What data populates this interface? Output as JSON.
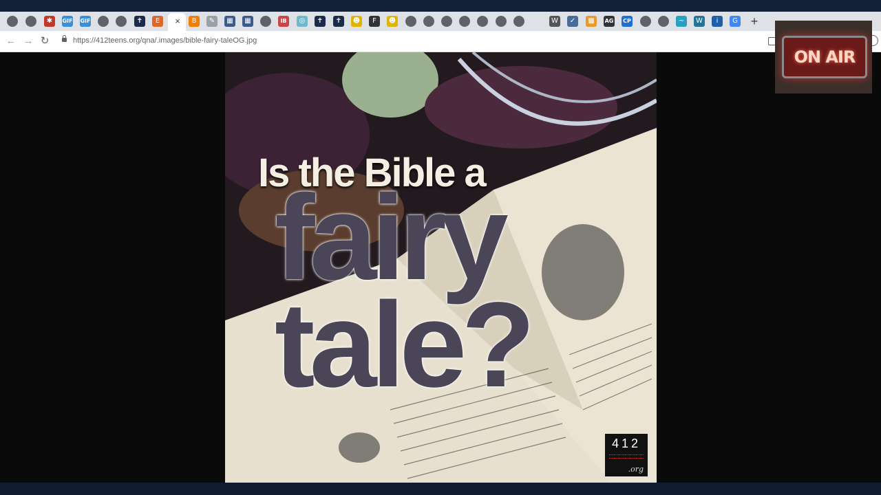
{
  "browser": {
    "address_url": "https://412teens.org/qna/.images/bible-fairy-taleOG.jpg",
    "tab_close_glyph": "×",
    "new_tab_glyph": "+",
    "back_glyph": "←",
    "forward_glyph": "→",
    "reload_glyph": "↻"
  },
  "tabs": [
    {
      "icon": "globe-icon",
      "glyph": ""
    },
    {
      "icon": "globe-icon",
      "glyph": ""
    },
    {
      "icon": "red-badge-icon",
      "glyph": "✱"
    },
    {
      "icon": "gif-icon",
      "glyph": "GIF"
    },
    {
      "icon": "gif-icon",
      "glyph": "GIF"
    },
    {
      "icon": "globe-icon",
      "glyph": ""
    },
    {
      "icon": "globe-icon",
      "glyph": ""
    },
    {
      "icon": "cross-icon",
      "glyph": "✝"
    },
    {
      "icon": "e-letter-icon",
      "glyph": "E"
    },
    {
      "icon": "blogger-icon",
      "glyph": "B"
    },
    {
      "icon": "bulb-icon",
      "glyph": "✎"
    },
    {
      "icon": "grid-icon",
      "glyph": "▦"
    },
    {
      "icon": "grid-icon",
      "glyph": "▦"
    },
    {
      "icon": "globe-icon",
      "glyph": ""
    },
    {
      "icon": "ib-icon",
      "glyph": "IB"
    },
    {
      "icon": "image-icon",
      "glyph": "◎"
    },
    {
      "icon": "cross-icon",
      "glyph": "✝"
    },
    {
      "icon": "cross-icon",
      "glyph": "✝"
    },
    {
      "icon": "smiley-icon",
      "glyph": "☻"
    },
    {
      "icon": "f-letter-icon",
      "glyph": "F"
    },
    {
      "icon": "smiley-icon",
      "glyph": "☻"
    },
    {
      "icon": "globe-icon",
      "glyph": ""
    },
    {
      "icon": "globe-icon",
      "glyph": ""
    },
    {
      "icon": "globe-icon",
      "glyph": ""
    },
    {
      "icon": "globe-icon",
      "glyph": ""
    },
    {
      "icon": "globe-icon",
      "glyph": ""
    },
    {
      "icon": "globe-icon",
      "glyph": ""
    },
    {
      "icon": "globe-icon",
      "glyph": ""
    },
    {
      "icon": "wikipedia-icon",
      "glyph": "W"
    },
    {
      "icon": "compass-icon",
      "glyph": "✓"
    },
    {
      "icon": "gift-icon",
      "glyph": "▩"
    },
    {
      "icon": "ag-icon",
      "glyph": "AG"
    },
    {
      "icon": "cp-icon",
      "glyph": "CP"
    },
    {
      "icon": "globe-icon",
      "glyph": ""
    },
    {
      "icon": "globe-icon",
      "glyph": ""
    },
    {
      "icon": "wave-icon",
      "glyph": "~"
    },
    {
      "icon": "wordpress-icon",
      "glyph": "W"
    },
    {
      "icon": "info-icon",
      "glyph": "i"
    },
    {
      "icon": "google-icon",
      "glyph": "G"
    }
  ],
  "poster": {
    "line1": "Is the Bible a",
    "line2": "fairy",
    "line3": "tale?",
    "logo_number": "412",
    "logo_org": ".org"
  },
  "overlay": {
    "onair_text": "ON AIR"
  },
  "colors": {
    "tabbar_bg": "#dee1e6",
    "poster_title_dark": "#4a4658",
    "onair_red": "#6b1a1a"
  }
}
